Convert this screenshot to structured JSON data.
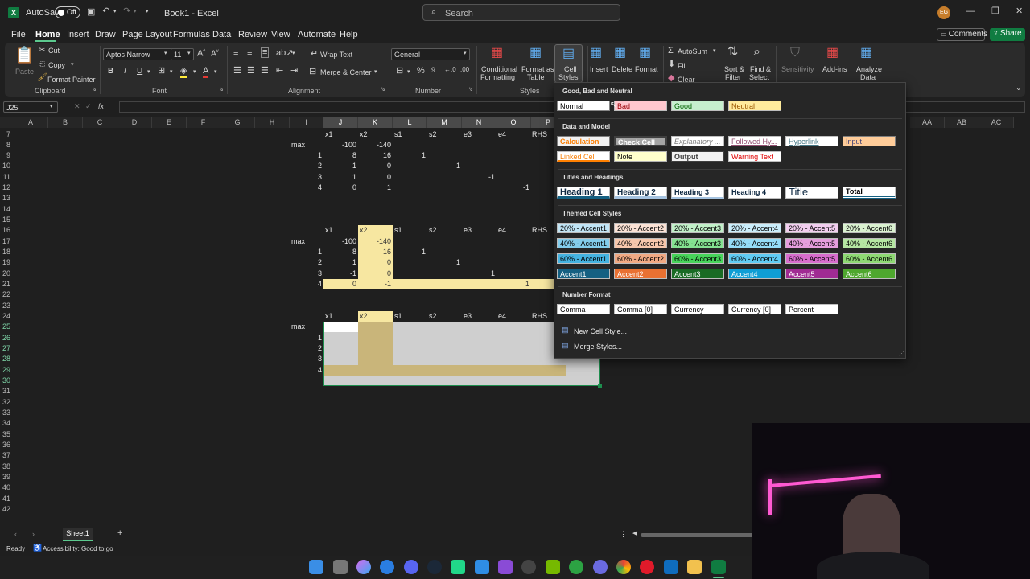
{
  "title_bar": {
    "autosave_label": "AutoSave",
    "autosave_state": "Off",
    "file_name": "Book1 - Excel",
    "search_placeholder": "Search",
    "user_initials": "EG"
  },
  "menu": {
    "tabs": [
      "File",
      "Home",
      "Insert",
      "Draw",
      "Page Layout",
      "Formulas",
      "Data",
      "Review",
      "View",
      "Automate",
      "Help"
    ],
    "active": "Home",
    "comments": "Comments",
    "share": "Share"
  },
  "ribbon": {
    "clipboard": {
      "paste": "Paste",
      "cut": "Cut",
      "copy": "Copy",
      "format_painter": "Format Painter",
      "group": "Clipboard"
    },
    "font": {
      "name": "Aptos Narrow",
      "size": "11",
      "bold": "B",
      "italic": "I",
      "underline": "U",
      "group": "Font"
    },
    "alignment": {
      "wrap": "Wrap Text",
      "merge": "Merge & Center",
      "group": "Alignment"
    },
    "number": {
      "format": "General",
      "percent": "%",
      "group": "Number"
    },
    "styles": {
      "conditional": "Conditional",
      "conditional2": "Formatting",
      "format_as": "Format as",
      "format_as2": "Table",
      "cell": "Cell",
      "cell2": "Styles",
      "group": "Styles"
    },
    "cells": {
      "insert": "Insert",
      "delete": "Delete",
      "format": "Format"
    },
    "editing": {
      "autosum": "AutoSum",
      "fill": "Fill",
      "clear": "Clear",
      "sort": "Sort &",
      "sort2": "Filter",
      "find": "Find &",
      "find2": "Select"
    },
    "sensitivity": "Sensitivity",
    "addins": "Add-ins",
    "analyze": "Analyze",
    "analyze2": "Data"
  },
  "formula_bar": {
    "name_box": "J25",
    "fx": "fx"
  },
  "grid": {
    "cols": [
      "A",
      "B",
      "C",
      "D",
      "E",
      "F",
      "G",
      "H",
      "I",
      "J",
      "K",
      "L",
      "M",
      "N",
      "O",
      "P",
      "AA",
      "AB",
      "AC"
    ],
    "selected_cols": [
      "J",
      "K",
      "L",
      "M",
      "N",
      "O",
      "P"
    ],
    "rows": [
      "7",
      "8",
      "9",
      "10",
      "11",
      "12",
      "13",
      "14",
      "15",
      "16",
      "17",
      "18",
      "19",
      "20",
      "21",
      "22",
      "23",
      "24",
      "25",
      "26",
      "27",
      "28",
      "29",
      "30",
      "31",
      "32",
      "33",
      "34",
      "35",
      "36",
      "37",
      "38",
      "39",
      "40",
      "41",
      "42"
    ],
    "selected_rows": [
      "25",
      "26",
      "27",
      "28",
      "29",
      "30"
    ],
    "t1": {
      "header": [
        "x1",
        "x2",
        "s1",
        "s2",
        "e3",
        "e4",
        "RHS"
      ],
      "max_label": "max",
      "max": [
        "-100",
        "-140"
      ],
      "r1": {
        "id": "1",
        "x1": "8",
        "x2": "16",
        "s1": "1"
      },
      "r2": {
        "id": "2",
        "x1": "1",
        "x2": "0",
        "s2": "1"
      },
      "r3": {
        "id": "3",
        "x1": "1",
        "x2": "0",
        "e3": "-1"
      },
      "r4": {
        "id": "4",
        "x1": "0",
        "x2": "1",
        "e4": "-1"
      }
    },
    "t2": {
      "header": [
        "x1",
        "x2",
        "s1",
        "s2",
        "e3",
        "e4",
        "RHS"
      ],
      "max_label": "max",
      "max": [
        "-100",
        "-140"
      ],
      "r1": {
        "id": "1",
        "x1": "8",
        "x2": "16",
        "s1": "1"
      },
      "r2": {
        "id": "2",
        "x1": "1",
        "x2": "0",
        "s2": "1"
      },
      "r3": {
        "id": "3",
        "x1": "-1",
        "x2": "0",
        "e4": "1"
      },
      "r4": {
        "id": "4",
        "x1": "0",
        "x2": "-1",
        "rhs": "1"
      }
    },
    "t3": {
      "header": [
        "x1",
        "x2",
        "s1",
        "s2",
        "e3",
        "e4",
        "RHS"
      ],
      "max_label": "max",
      "ids": [
        "1",
        "2",
        "3",
        "4"
      ]
    }
  },
  "sheet_tab": "Sheet1",
  "status": {
    "ready": "Ready",
    "accessibility": "Accessibility: Good to go"
  },
  "cell_styles": {
    "good_bad_neutral": {
      "title": "Good, Bad and Neutral",
      "items": [
        "Normal",
        "Bad",
        "Good",
        "Neutral"
      ]
    },
    "data_model": {
      "title": "Data and Model",
      "row1": [
        "Calculation",
        "Check Cell",
        "Explanatory ...",
        "Followed Hy...",
        "Hyperlink",
        "Input"
      ],
      "row2": [
        "Linked Cell",
        "Note",
        "Output",
        "Warning Text"
      ]
    },
    "titles": {
      "title": "Titles and Headings",
      "items": [
        "Heading 1",
        "Heading 2",
        "Heading 3",
        "Heading 4",
        "Title",
        "Total"
      ]
    },
    "themed": {
      "title": "Themed Cell Styles",
      "row20": [
        "20% - Accent1",
        "20% - Accent2",
        "20% - Accent3",
        "20% - Accent4",
        "20% - Accent5",
        "20% - Accent6"
      ],
      "row40": [
        "40% - Accent1",
        "40% - Accent2",
        "40% - Accent3",
        "40% - Accent4",
        "40% - Accent5",
        "40% - Accent6"
      ],
      "row60": [
        "60% - Accent1",
        "60% - Accent2",
        "60% - Accent3",
        "60% - Accent4",
        "60% - Accent5",
        "60% - Accent6"
      ],
      "rowA": [
        "Accent1",
        "Accent2",
        "Accent3",
        "Accent4",
        "Accent5",
        "Accent6"
      ]
    },
    "number": {
      "title": "Number Format",
      "items": [
        "Comma",
        "Comma [0]",
        "Currency",
        "Currency [0]",
        "Percent"
      ]
    },
    "new_style": "New Cell Style...",
    "merge_styles": "Merge Styles..."
  },
  "colors": {
    "accent_green": "#107c41",
    "highlight": "#f7e7a1",
    "selection": "#cfcfcf"
  }
}
